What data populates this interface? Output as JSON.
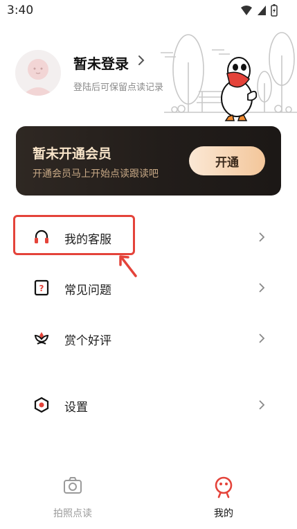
{
  "status_bar": {
    "time": "3:40"
  },
  "profile": {
    "title": "暂未登录",
    "subtitle": "登陆后可保留点读记录"
  },
  "vip": {
    "title": "暂未开通会员",
    "subtitle": "开通会员马上开始点读跟读吧",
    "button_label": "开通"
  },
  "menu": [
    {
      "label": "我的客服",
      "icon": "headset-icon"
    },
    {
      "label": "常见问题",
      "icon": "question-icon"
    },
    {
      "label": "赏个好评",
      "icon": "flower-rating-icon"
    },
    {
      "label": "设置",
      "icon": "settings-icon"
    }
  ],
  "bottom_nav": [
    {
      "label": "拍照点读",
      "icon": "camera-icon",
      "active": false
    },
    {
      "label": "我的",
      "icon": "profile-face-icon",
      "active": true
    }
  ],
  "colors": {
    "accent": "#e4433a",
    "card_bg": "#221d1a",
    "card_title": "#f7e3c8",
    "inactive": "#9a9a9a"
  }
}
